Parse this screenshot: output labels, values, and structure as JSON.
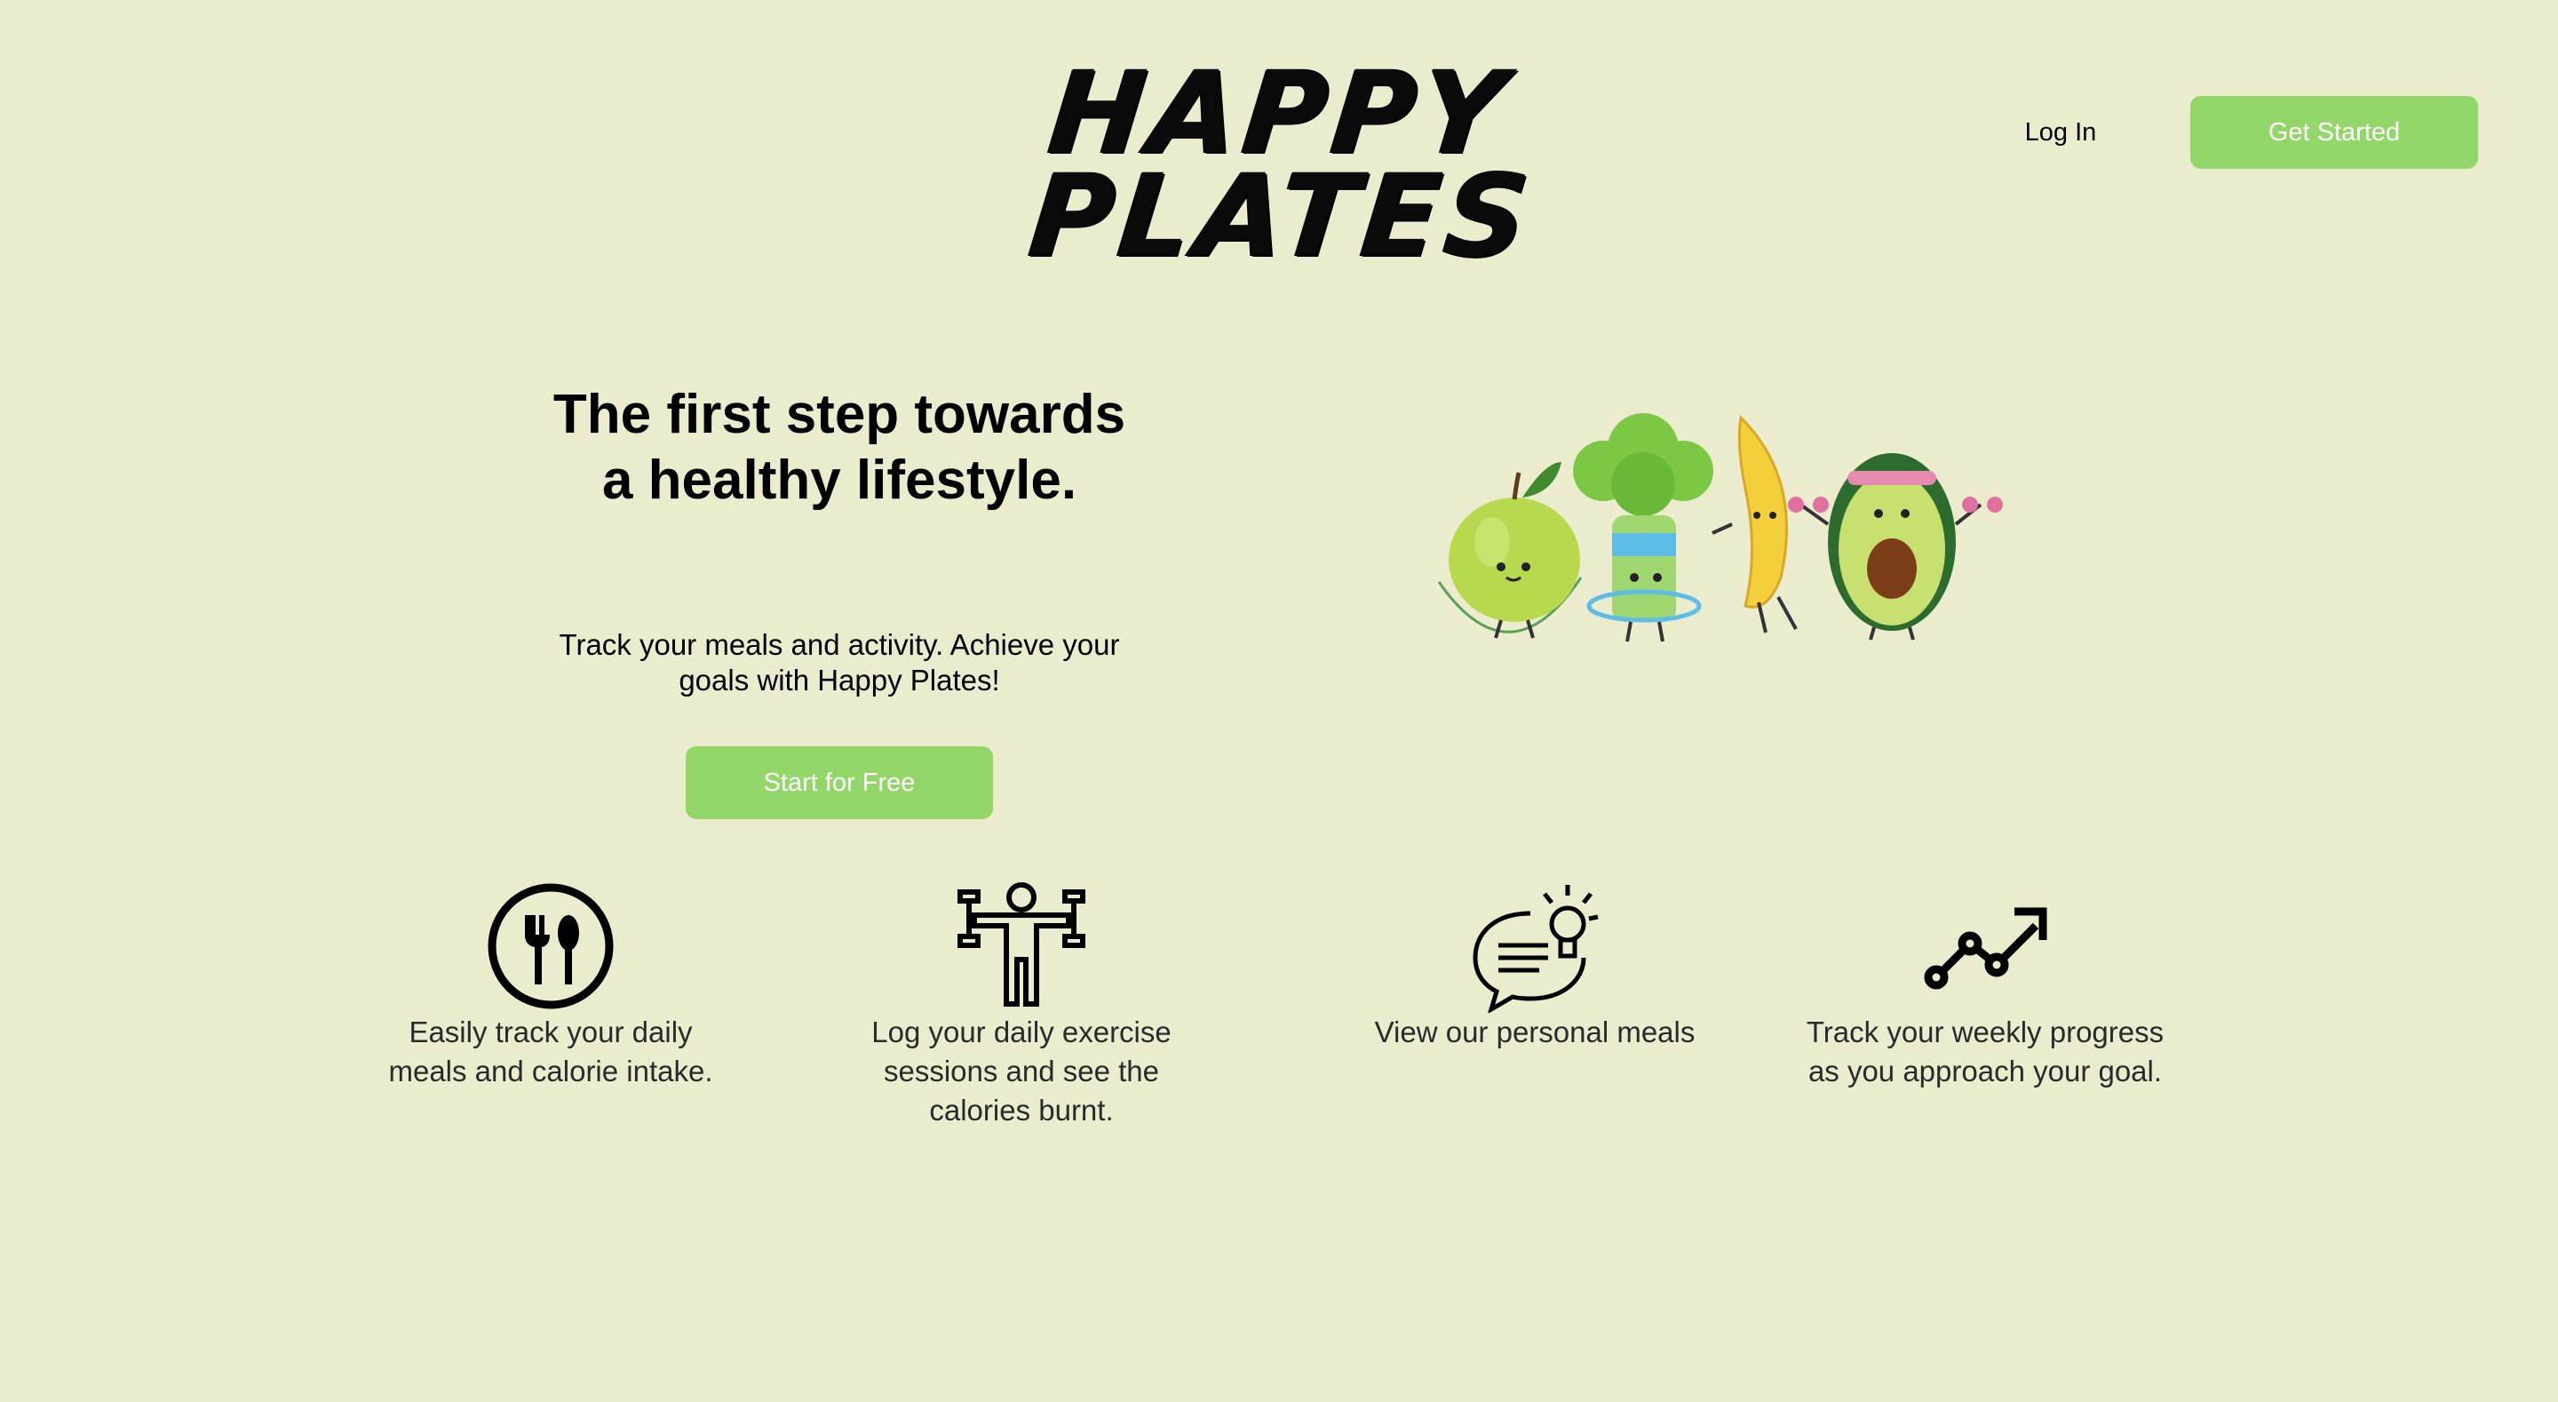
{
  "header": {
    "logo_line1": "HAPPY",
    "logo_line2": "PLATES",
    "login_label": "Log In",
    "get_started_label": "Get Started"
  },
  "hero": {
    "title": "The first step towards a healthy lifestyle.",
    "subtitle": "Track your meals and activity. Achieve your goals with Happy Plates!",
    "cta_label": "Start for Free",
    "illustration_icon": "fruit-and-vegetable-characters-exercising"
  },
  "features": [
    {
      "icon": "fork-spoon-icon",
      "text": "Easily track your daily\nmeals and calorie intake."
    },
    {
      "icon": "exercise-person-icon",
      "text": "Log your daily exercise\nsessions and see the\ncalories burnt."
    },
    {
      "icon": "chat-bulb-icon",
      "text": "View our personal meals"
    },
    {
      "icon": "progress-chart-icon",
      "text": "Track your weekly progress\nas you approach your goal."
    }
  ],
  "colors": {
    "background": "#ebecce",
    "accent_green": "#93d66a",
    "text": "#000000"
  }
}
